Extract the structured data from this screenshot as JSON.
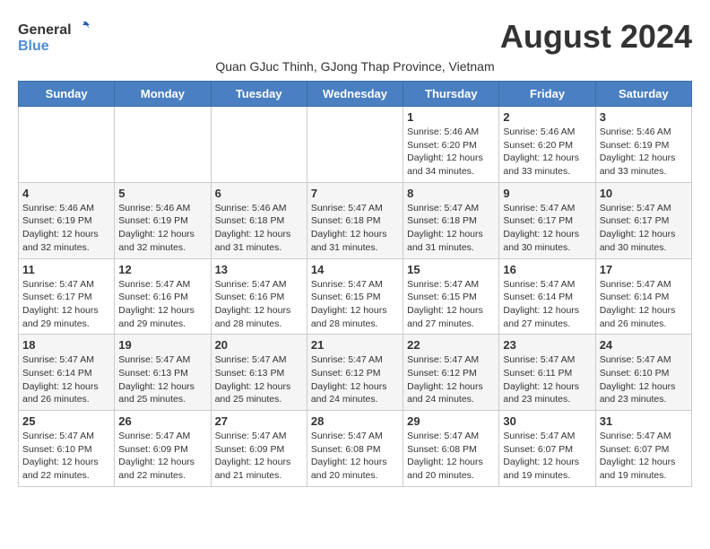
{
  "logo": {
    "general": "General",
    "blue": "Blue"
  },
  "title": "August 2024",
  "subtitle": "Quan GJuc Thinh, GJong Thap Province, Vietnam",
  "days_header": [
    "Sunday",
    "Monday",
    "Tuesday",
    "Wednesday",
    "Thursday",
    "Friday",
    "Saturday"
  ],
  "weeks": [
    [
      {
        "day": "",
        "info": ""
      },
      {
        "day": "",
        "info": ""
      },
      {
        "day": "",
        "info": ""
      },
      {
        "day": "",
        "info": ""
      },
      {
        "day": "1",
        "info": "Sunrise: 5:46 AM\nSunset: 6:20 PM\nDaylight: 12 hours\nand 34 minutes."
      },
      {
        "day": "2",
        "info": "Sunrise: 5:46 AM\nSunset: 6:20 PM\nDaylight: 12 hours\nand 33 minutes."
      },
      {
        "day": "3",
        "info": "Sunrise: 5:46 AM\nSunset: 6:19 PM\nDaylight: 12 hours\nand 33 minutes."
      }
    ],
    [
      {
        "day": "4",
        "info": "Sunrise: 5:46 AM\nSunset: 6:19 PM\nDaylight: 12 hours\nand 32 minutes."
      },
      {
        "day": "5",
        "info": "Sunrise: 5:46 AM\nSunset: 6:19 PM\nDaylight: 12 hours\nand 32 minutes."
      },
      {
        "day": "6",
        "info": "Sunrise: 5:46 AM\nSunset: 6:18 PM\nDaylight: 12 hours\nand 31 minutes."
      },
      {
        "day": "7",
        "info": "Sunrise: 5:47 AM\nSunset: 6:18 PM\nDaylight: 12 hours\nand 31 minutes."
      },
      {
        "day": "8",
        "info": "Sunrise: 5:47 AM\nSunset: 6:18 PM\nDaylight: 12 hours\nand 31 minutes."
      },
      {
        "day": "9",
        "info": "Sunrise: 5:47 AM\nSunset: 6:17 PM\nDaylight: 12 hours\nand 30 minutes."
      },
      {
        "day": "10",
        "info": "Sunrise: 5:47 AM\nSunset: 6:17 PM\nDaylight: 12 hours\nand 30 minutes."
      }
    ],
    [
      {
        "day": "11",
        "info": "Sunrise: 5:47 AM\nSunset: 6:17 PM\nDaylight: 12 hours\nand 29 minutes."
      },
      {
        "day": "12",
        "info": "Sunrise: 5:47 AM\nSunset: 6:16 PM\nDaylight: 12 hours\nand 29 minutes."
      },
      {
        "day": "13",
        "info": "Sunrise: 5:47 AM\nSunset: 6:16 PM\nDaylight: 12 hours\nand 28 minutes."
      },
      {
        "day": "14",
        "info": "Sunrise: 5:47 AM\nSunset: 6:15 PM\nDaylight: 12 hours\nand 28 minutes."
      },
      {
        "day": "15",
        "info": "Sunrise: 5:47 AM\nSunset: 6:15 PM\nDaylight: 12 hours\nand 27 minutes."
      },
      {
        "day": "16",
        "info": "Sunrise: 5:47 AM\nSunset: 6:14 PM\nDaylight: 12 hours\nand 27 minutes."
      },
      {
        "day": "17",
        "info": "Sunrise: 5:47 AM\nSunset: 6:14 PM\nDaylight: 12 hours\nand 26 minutes."
      }
    ],
    [
      {
        "day": "18",
        "info": "Sunrise: 5:47 AM\nSunset: 6:14 PM\nDaylight: 12 hours\nand 26 minutes."
      },
      {
        "day": "19",
        "info": "Sunrise: 5:47 AM\nSunset: 6:13 PM\nDaylight: 12 hours\nand 25 minutes."
      },
      {
        "day": "20",
        "info": "Sunrise: 5:47 AM\nSunset: 6:13 PM\nDaylight: 12 hours\nand 25 minutes."
      },
      {
        "day": "21",
        "info": "Sunrise: 5:47 AM\nSunset: 6:12 PM\nDaylight: 12 hours\nand 24 minutes."
      },
      {
        "day": "22",
        "info": "Sunrise: 5:47 AM\nSunset: 6:12 PM\nDaylight: 12 hours\nand 24 minutes."
      },
      {
        "day": "23",
        "info": "Sunrise: 5:47 AM\nSunset: 6:11 PM\nDaylight: 12 hours\nand 23 minutes."
      },
      {
        "day": "24",
        "info": "Sunrise: 5:47 AM\nSunset: 6:10 PM\nDaylight: 12 hours\nand 23 minutes."
      }
    ],
    [
      {
        "day": "25",
        "info": "Sunrise: 5:47 AM\nSunset: 6:10 PM\nDaylight: 12 hours\nand 22 minutes."
      },
      {
        "day": "26",
        "info": "Sunrise: 5:47 AM\nSunset: 6:09 PM\nDaylight: 12 hours\nand 22 minutes."
      },
      {
        "day": "27",
        "info": "Sunrise: 5:47 AM\nSunset: 6:09 PM\nDaylight: 12 hours\nand 21 minutes."
      },
      {
        "day": "28",
        "info": "Sunrise: 5:47 AM\nSunset: 6:08 PM\nDaylight: 12 hours\nand 20 minutes."
      },
      {
        "day": "29",
        "info": "Sunrise: 5:47 AM\nSunset: 6:08 PM\nDaylight: 12 hours\nand 20 minutes."
      },
      {
        "day": "30",
        "info": "Sunrise: 5:47 AM\nSunset: 6:07 PM\nDaylight: 12 hours\nand 19 minutes."
      },
      {
        "day": "31",
        "info": "Sunrise: 5:47 AM\nSunset: 6:07 PM\nDaylight: 12 hours\nand 19 minutes."
      }
    ]
  ]
}
